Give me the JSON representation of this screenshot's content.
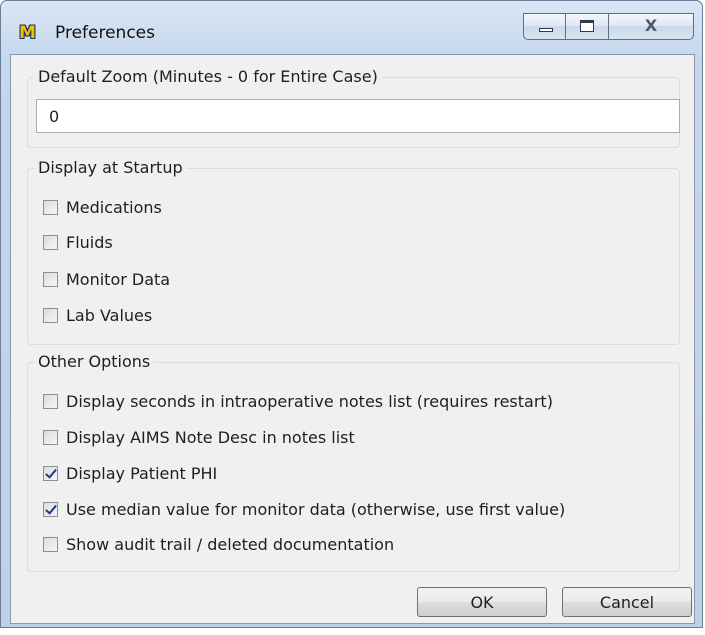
{
  "window": {
    "title": "Preferences",
    "app_icon_text": "M",
    "close_glyph": "X"
  },
  "zoom_group": {
    "legend": "Default Zoom (Minutes - 0 for Entire Case)",
    "value": "0"
  },
  "startup_group": {
    "legend": "Display at Startup",
    "items": [
      {
        "label": "Medications",
        "checked": false
      },
      {
        "label": "Fluids",
        "checked": false
      },
      {
        "label": "Monitor Data",
        "checked": false
      },
      {
        "label": "Lab Values",
        "checked": false
      }
    ]
  },
  "other_group": {
    "legend": "Other Options",
    "items": [
      {
        "label": "Display seconds in intraoperative notes list (requires restart)",
        "checked": false
      },
      {
        "label": "Display AIMS Note Desc in notes list",
        "checked": false
      },
      {
        "label": "Display Patient PHI",
        "checked": true
      },
      {
        "label": "Use median value for monitor data (otherwise, use first value)",
        "checked": true
      },
      {
        "label": "Show audit trail / deleted documentation",
        "checked": false
      }
    ]
  },
  "buttons": {
    "ok": "OK",
    "cancel": "Cancel"
  }
}
